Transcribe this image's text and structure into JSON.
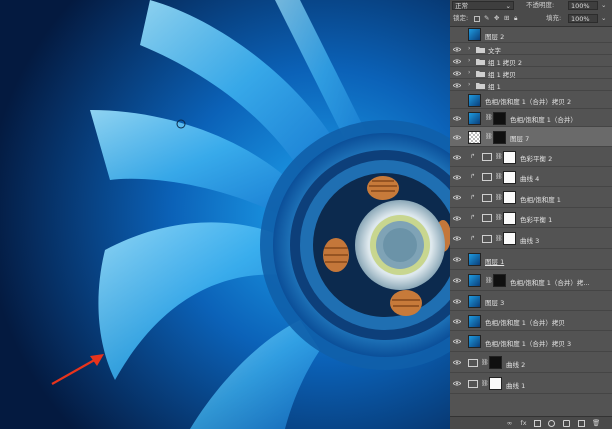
{
  "canvas": {
    "description_icons": [
      "fan-artwork",
      "red-arrow-annotation",
      "brush-cursor"
    ]
  },
  "panel": {
    "blend_mode": "正常",
    "opacity_label": "不透明度:",
    "opacity_value": "100%",
    "lock_label": "锁定:",
    "fill_label": "填充:",
    "fill_value": "100%",
    "layers": [
      {
        "name": "图层 2",
        "type": "image",
        "visible": false
      },
      {
        "name": "文字",
        "type": "group",
        "visible": true
      },
      {
        "name": "组 1 拷贝 2",
        "type": "group",
        "visible": true
      },
      {
        "name": "组 1 拷贝",
        "type": "group",
        "visible": true
      },
      {
        "name": "组 1",
        "type": "group",
        "visible": true
      },
      {
        "name": "色相/饱和度 1（合并）拷贝 2",
        "type": "image",
        "visible": false
      },
      {
        "name": "色相/饱和度 1（合并）",
        "type": "image-mask",
        "visible": true
      },
      {
        "name": "图层 7",
        "type": "checker-mask",
        "visible": true,
        "selected": true
      },
      {
        "name": "色彩平衡 2",
        "type": "adjust-balance",
        "visible": true,
        "clipped": true
      },
      {
        "name": "曲线 4",
        "type": "adjust-curve",
        "visible": true,
        "clipped": true
      },
      {
        "name": "色相/饱和度 1",
        "type": "adjust-hue",
        "visible": true,
        "clipped": true
      },
      {
        "name": "色彩平衡 1",
        "type": "adjust-balance",
        "visible": true,
        "clipped": true
      },
      {
        "name": "曲线 3",
        "type": "adjust-curve",
        "visible": true,
        "clipped": true
      },
      {
        "name": "图层 1",
        "type": "image",
        "visible": true,
        "underline": true
      },
      {
        "name": "色相/饱和度 1（合并）拷...",
        "type": "image-mask",
        "visible": true
      },
      {
        "name": "图层 3",
        "type": "image",
        "visible": true
      },
      {
        "name": "色相/饱和度 1（合并）拷贝",
        "type": "image",
        "visible": true
      },
      {
        "name": "色相/饱和度 1（合并）拷贝 3",
        "type": "image",
        "visible": true
      },
      {
        "name": "曲线 2",
        "type": "adjust-curve-mask",
        "visible": true
      },
      {
        "name": "曲线 1",
        "type": "adjust-curve-white",
        "visible": true
      }
    ],
    "bottom_icons": [
      "link-icon",
      "fx-icon",
      "mask-icon",
      "adjustment-icon",
      "folder-icon",
      "new-layer-icon",
      "trash-icon"
    ],
    "bottom_fx_label": "fx"
  },
  "colors": {
    "panel_bg": "#535353",
    "selected_row": "#6a6a6a",
    "arrow": "#e8341c"
  }
}
